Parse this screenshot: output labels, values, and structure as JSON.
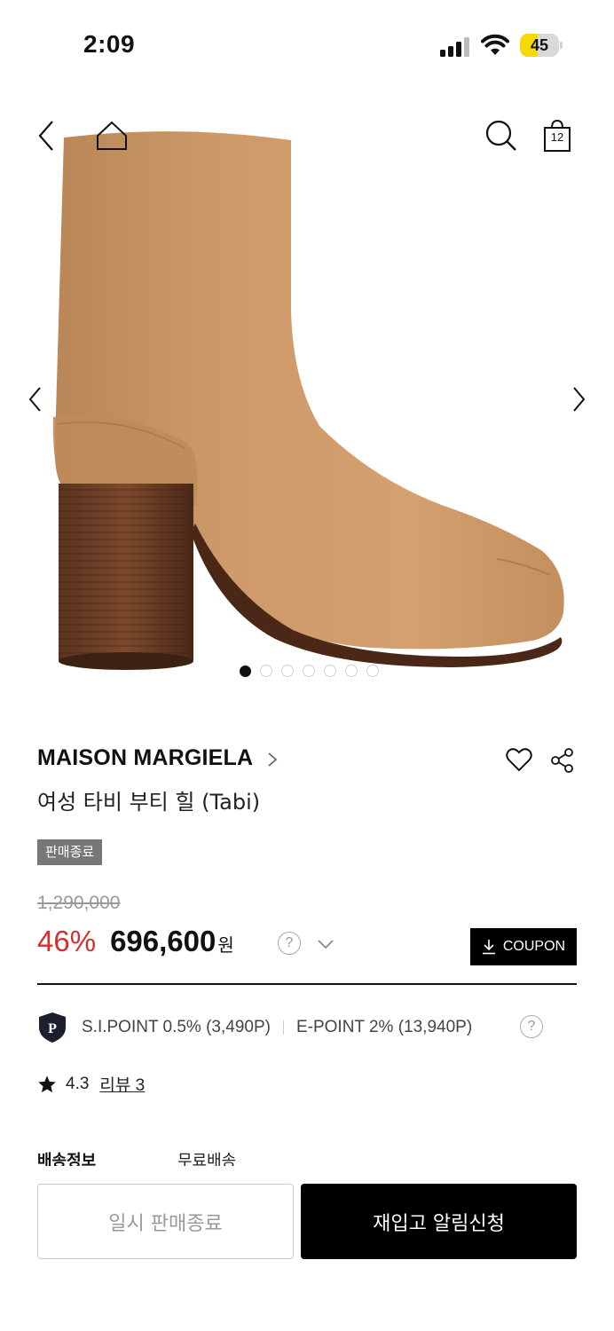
{
  "status_bar": {
    "time": "2:09",
    "battery_level": "45",
    "battery_fraction": 0.45,
    "battery_color": "#f5d900"
  },
  "nav": {
    "back_icon": "chevron-left-icon",
    "home_icon": "home-icon",
    "search_icon": "search-icon",
    "cart_icon": "shopping-bag-icon",
    "cart_count": "12"
  },
  "gallery": {
    "image_description_icon": "boot-image",
    "prev_icon": "chevron-left-icon",
    "next_icon": "chevron-right-icon",
    "total_slides": 7,
    "active_slide": 1
  },
  "product": {
    "brand": "MAISON MARGIELA",
    "title": "여성 타비 부티 힐 (Tabi)",
    "status_badge": "판매종료",
    "original_price": "1,290,000",
    "discount": "46%",
    "price": "696,600",
    "currency": "원",
    "help_mark": "?",
    "coupon_label": "COUPON",
    "accent_color": "#d0312d"
  },
  "points": {
    "si_point": "S.I.POINT 0.5% (3,490P)",
    "e_point": "E-POINT 2% (13,940P)",
    "help_mark": "?"
  },
  "rating": {
    "score": "4.3",
    "reviews": "리뷰 3"
  },
  "shipping": {
    "label": "배송정보",
    "value": "무료배송"
  },
  "actions": {
    "pause_label": "일시 판매종료",
    "restock_label": "재입고 알림신청"
  }
}
